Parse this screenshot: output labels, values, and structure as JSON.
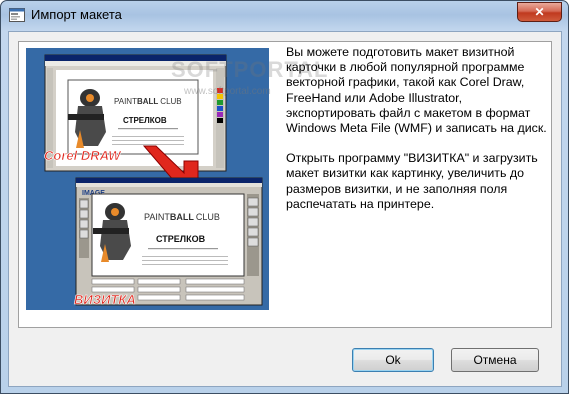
{
  "window": {
    "title": "Импорт макета",
    "close_symbol": "✕"
  },
  "description": {
    "paragraph1": "Вы можете подготовить макет визитной карточки в любой популярной программе векторной графики, такой как Corel Draw, FreeHand или Adobe Illustrator, экспортировать файл с макетом в формат Windows Meta File (WMF) и записать на диск.",
    "paragraph2": "Открыть программу \"ВИЗИТКА\" и загрузить макет визитки как картинку, увеличить до размеров визитки, и не заполняя поля распечатать на принтере."
  },
  "illustration": {
    "corel_label": "Corel DRAW",
    "vizitka_label": "ВИЗИТКА",
    "image_label": "IMAGE",
    "card_brand_light": "PAINT",
    "card_brand_bold": "BALL",
    "card_brand_club": "CLUB",
    "card_name": "СТРЕЛКОВ"
  },
  "watermark": {
    "logo": "SOFTPORTAL",
    "url": "www.softportal.com"
  },
  "buttons": {
    "ok": "Ok",
    "cancel": "Отмена"
  },
  "colors": {
    "illustration_bg": "#356aa6",
    "label_red": "#e0271d",
    "close_red": "#c0391f"
  }
}
